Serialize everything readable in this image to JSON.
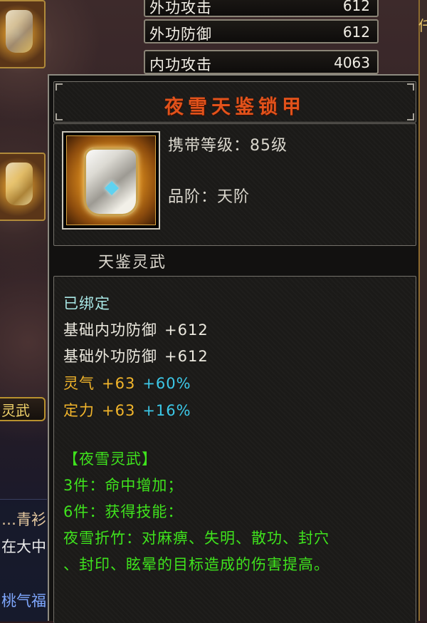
{
  "background": {
    "stats": [
      {
        "name": "外功攻击",
        "value": "612"
      },
      {
        "name": "外功防御",
        "value": "612"
      },
      {
        "name": "内功攻击",
        "value": "4063"
      }
    ],
    "side_button": "灵武",
    "chat_lines": [
      {
        "text": "…青衫",
        "color": "#e6c9a0"
      },
      {
        "text": "在大中",
        "color": "#e9e9e9"
      },
      {
        "text": "桃气福",
        "color": "#7fa8ff"
      }
    ],
    "right_glyph": "仟"
  },
  "tooltip": {
    "title": "夜雪天鉴锁甲",
    "item_icon": "armor-icon",
    "carry_level": "携带等级：85级",
    "grade": "品阶：天阶",
    "series": "天鉴灵武",
    "bound": "已绑定",
    "base_attrs": [
      {
        "label": "基础内功防御",
        "value": "+612"
      },
      {
        "label": "基础外功防御",
        "value": "+612"
      }
    ],
    "bonus_attrs": [
      {
        "label": "灵气",
        "value": "+63",
        "percent": "+60%"
      },
      {
        "label": "定力",
        "value": "+63",
        "percent": "+16%"
      }
    ],
    "set": {
      "name": "【夜雪灵武】",
      "piece3": "3件：命中增加；",
      "piece6": "6件：获得技能：",
      "skill_line1": "夜雪折竹：对麻痹、失明、散功、封穴",
      "skill_line2": "、封印、眩晕的目标造成的伤害提高。"
    }
  },
  "colors": {
    "title": "#e2521b",
    "bound": "#a9e8e6",
    "bonus": "#f2b52b",
    "percent": "#3cc8e8",
    "set_text": "#3fe31d"
  }
}
